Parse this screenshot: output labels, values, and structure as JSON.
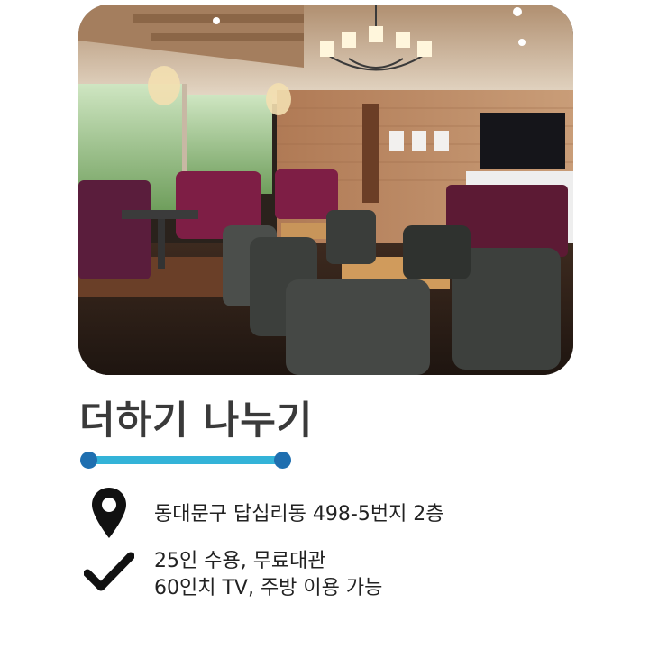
{
  "card": {
    "title": "더하기 나누기",
    "address_icon": "location-pin-icon",
    "address": "동대문구 답십리동 498-5번지 2층",
    "features_icon": "checkmark-icon",
    "features_line_1": "25인 수용, 무료대관",
    "features_line_2": "60인치 TV, 주방 이용 가능"
  },
  "colors": {
    "title": "#3a3a3a",
    "accent_line": "#33b3d8",
    "accent_dots": "#1f6fb0",
    "icons": "#111111"
  }
}
